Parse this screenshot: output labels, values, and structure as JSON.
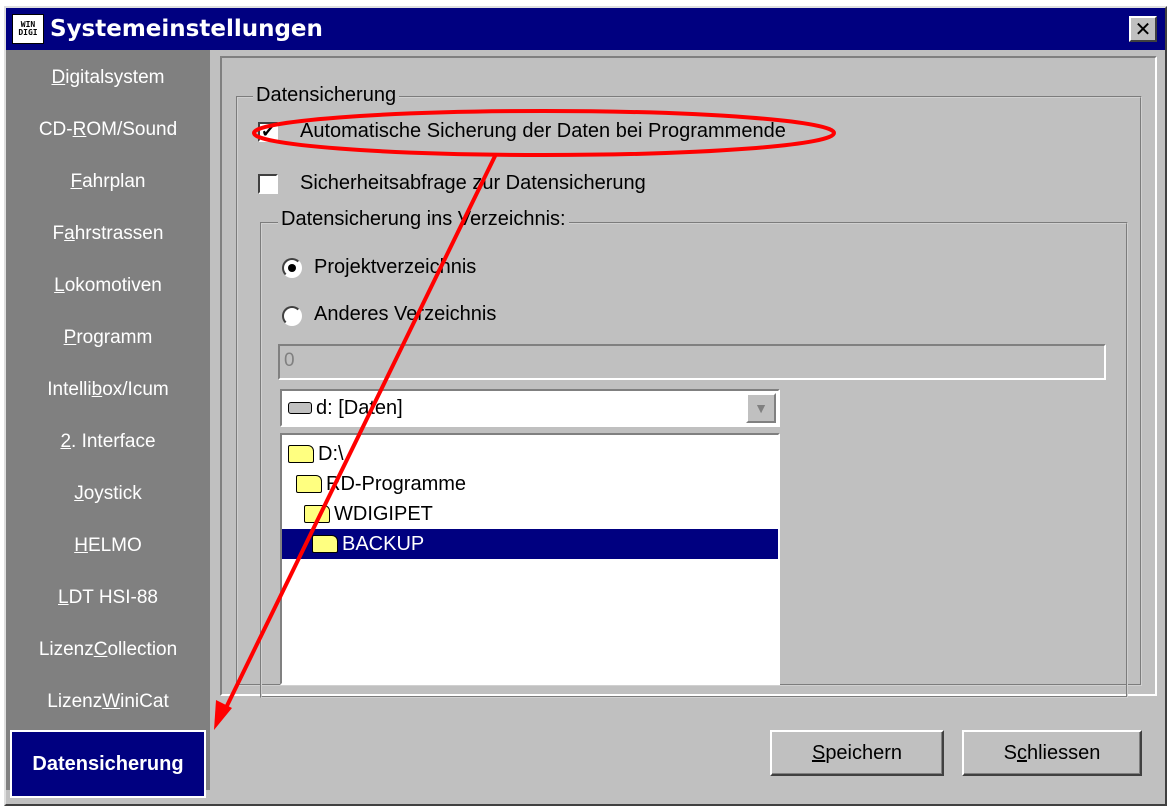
{
  "window": {
    "title": "Systemeinstellungen",
    "app_icon_line1": "WIN",
    "app_icon_line2": "DIGI",
    "close_glyph": "✕"
  },
  "sidebar": {
    "items": [
      {
        "pre": "",
        "u": "D",
        "post": "igitalsystem"
      },
      {
        "pre": "CD-",
        "u": "R",
        "post": "OM/Sound"
      },
      {
        "pre": "",
        "u": "F",
        "post": "ahrplan"
      },
      {
        "pre": "F",
        "u": "a",
        "post": "hrstrassen"
      },
      {
        "pre": "",
        "u": "L",
        "post": "okomotiven"
      },
      {
        "pre": "",
        "u": "P",
        "post": "rogramm"
      },
      {
        "pre": "Intelli",
        "u": "b",
        "post": "ox/Icum"
      },
      {
        "pre": "",
        "u": "2",
        "post": ". Interface"
      },
      {
        "pre": "",
        "u": "J",
        "post": "oystick"
      },
      {
        "pre": "",
        "u": "H",
        "post": "ELMO"
      },
      {
        "pre": "",
        "u": "L",
        "post": "DT HSI-88"
      },
      {
        "pre": "Lizenz ",
        "u": "C",
        "post": "ollection"
      },
      {
        "pre": "Lizenz ",
        "u": "W",
        "post": "iniCat"
      }
    ],
    "active_label": "Datensicherung"
  },
  "backup": {
    "group_label": "Datensicherung",
    "auto_backup_label": "Automatische Sicherung der Daten bei Programmende",
    "auto_backup_checked": true,
    "confirm_label": "Sicherheitsabfrage zur Datensicherung",
    "confirm_checked": false,
    "dir_group_label": "Datensicherung ins Verzeichnis:",
    "radio_project_label": "Projektverzeichnis",
    "radio_other_label": "Anderes Verzeichnis",
    "selected_radio": "Projektverzeichnis",
    "path_value": "0",
    "drive_value": "d: [Daten]",
    "dir_items": [
      "D:\\",
      "RD-Programme",
      "WDIGIPET",
      "BACKUP"
    ],
    "selected_dir": "BACKUP"
  },
  "buttons": {
    "save_pre": "",
    "save_u": "S",
    "save_post": "peichern",
    "close_pre": "S",
    "close_u": "c",
    "close_post": "hliessen"
  },
  "icons": [
    "app-icon",
    "close-icon",
    "checkbox-check-icon",
    "radio-dot-icon",
    "drive-icon",
    "dropdown-arrow-icon",
    "folder-icon"
  ],
  "colors": {
    "titlebar": "#000080",
    "sidebar": "#808080",
    "dialog": "#c0c0c0",
    "selection": "#000080",
    "annotation": "#ff0000"
  }
}
